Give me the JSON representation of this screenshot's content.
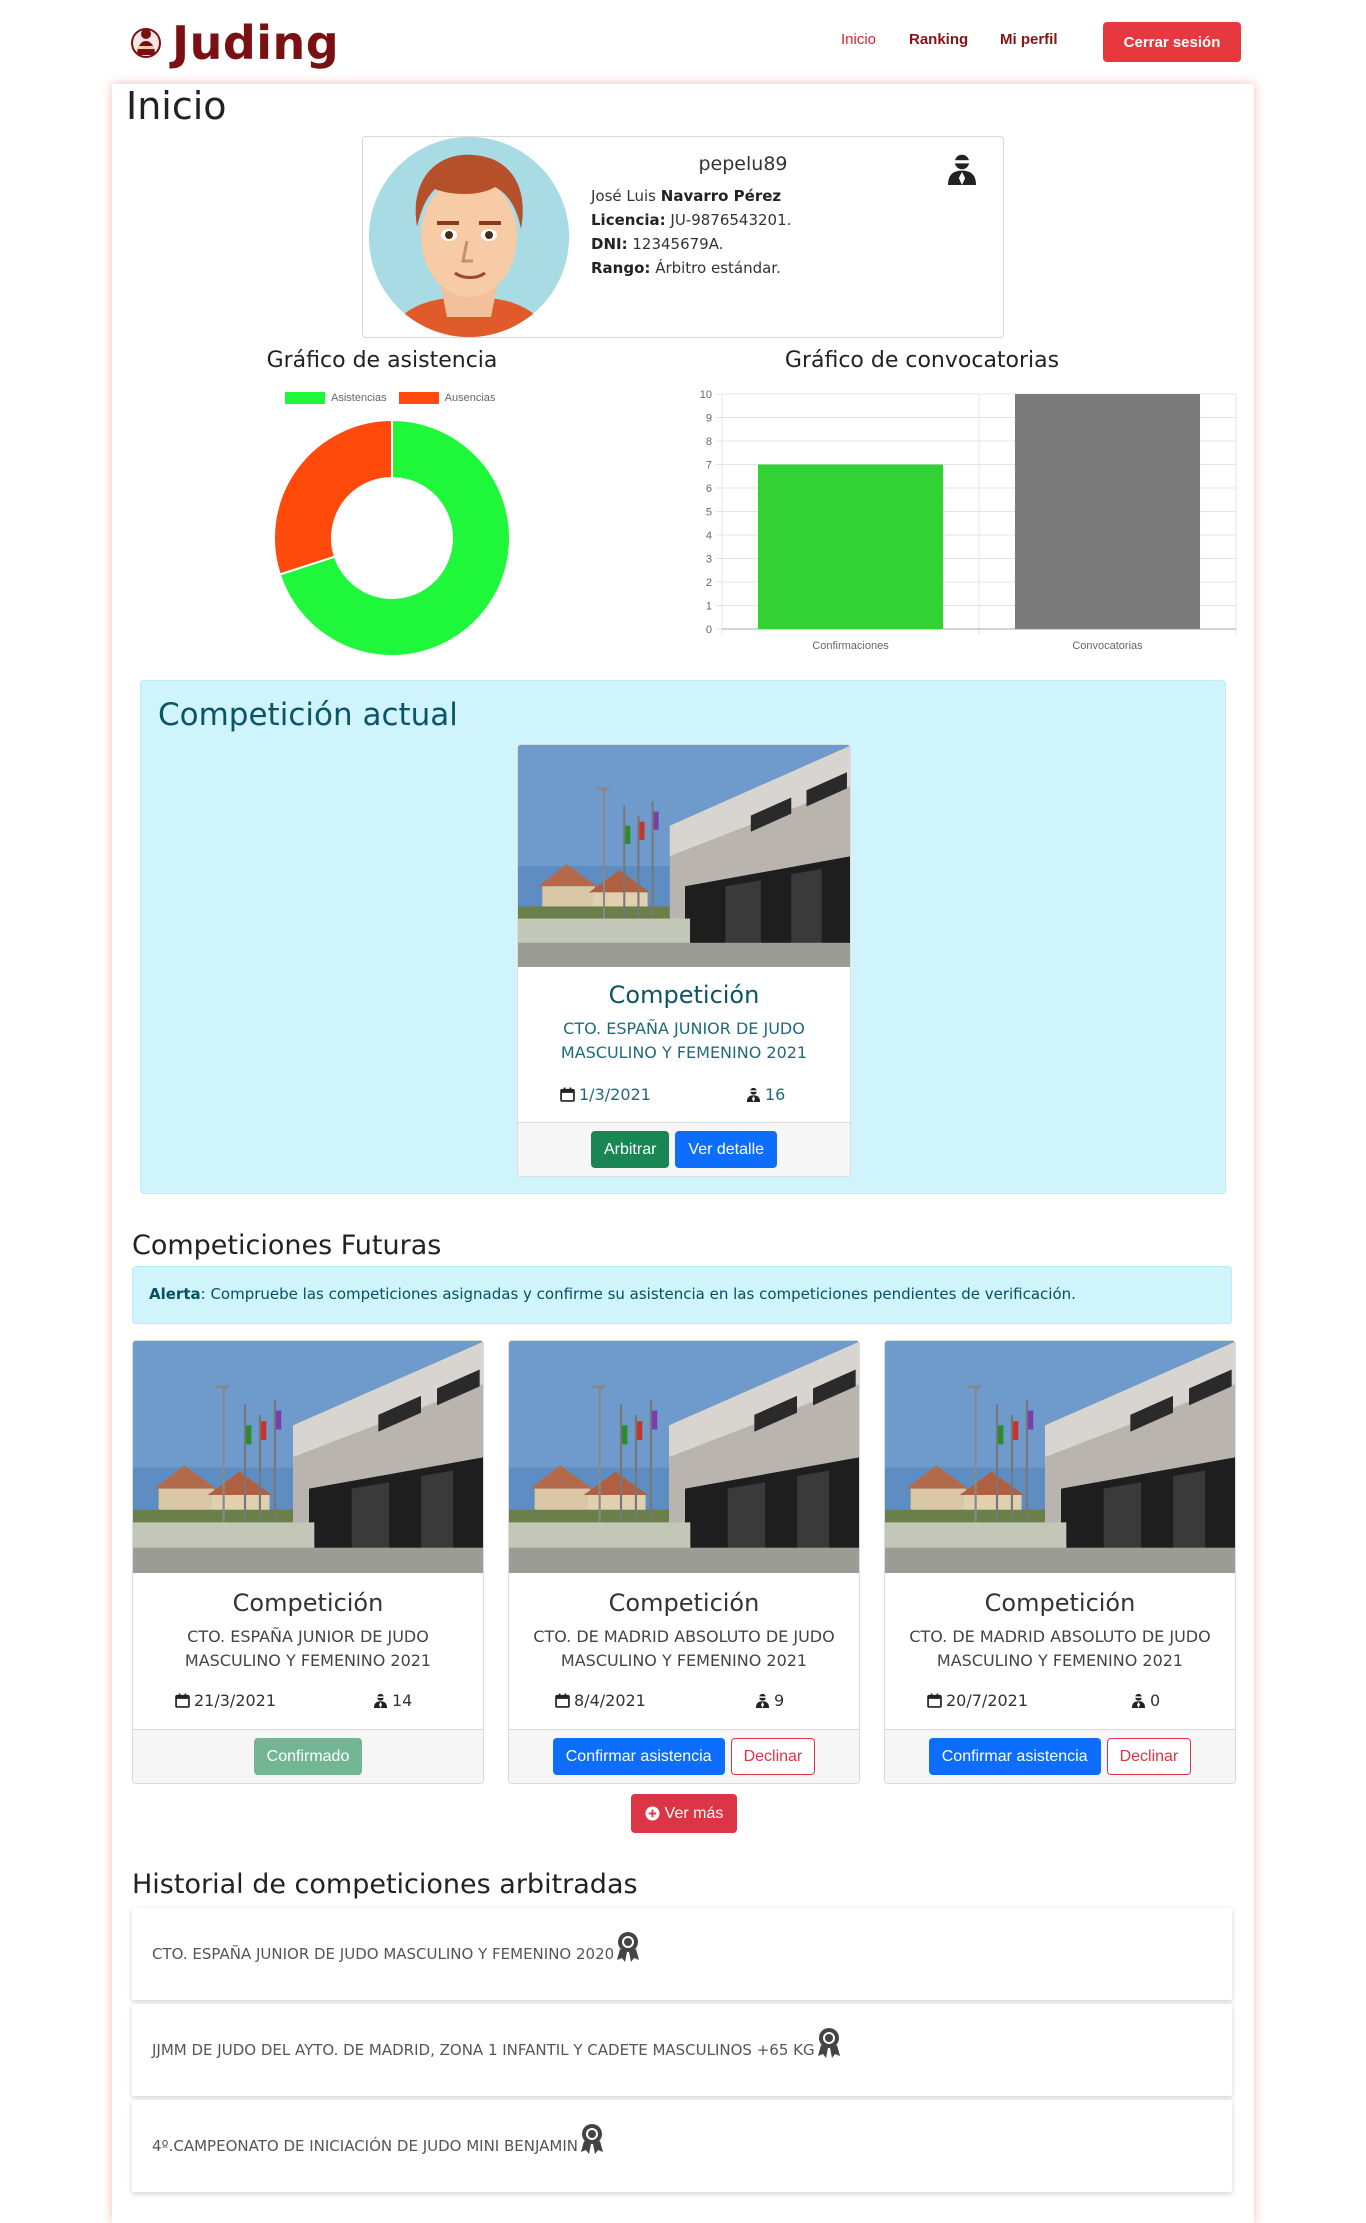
{
  "navbar": {
    "brand": "Juding",
    "links": [
      "Inicio",
      "Ranking",
      "Mi perfil"
    ],
    "logout": "Cerrar sesión"
  },
  "page": {
    "title": "Inicio"
  },
  "profile": {
    "username": "pepelu89",
    "name_first": "José Luis",
    "name_last": "Navarro Pérez",
    "license_label": "Licencia:",
    "license": "JU-9876543201.",
    "dni_label": "DNI:",
    "dni": "12345679A.",
    "rank_label": "Rango:",
    "rank": "Árbitro estándar."
  },
  "chart_data": [
    {
      "type": "pie",
      "title": "Gráfico de asistencia",
      "categories": [
        "Asistencias",
        "Ausencias"
      ],
      "values": [
        70,
        30
      ],
      "colors": [
        "#1ff73b",
        "#ff4a0c"
      ],
      "legend": "top"
    },
    {
      "type": "bar",
      "title": "Gráfico de convocatorias",
      "categories": [
        "Confirmaciones",
        "Convocatorias"
      ],
      "values": [
        7,
        10
      ],
      "colors": [
        "#32d234",
        "#7b7b7b"
      ],
      "ylim": [
        0,
        10
      ],
      "yticks": [
        "0",
        "1",
        "2",
        "3",
        "4",
        "5",
        "6",
        "7",
        "8",
        "9",
        "10"
      ],
      "grid": true
    }
  ],
  "current": {
    "section_title": "Competición actual",
    "card": {
      "title": "Competición",
      "name": "CTO. ESPAÑA JUNIOR DE JUDO MASCULINO Y FEMENINO 2021",
      "date": "1/3/2021",
      "referees": "16",
      "btn_referee": "Arbitrar",
      "btn_detail": "Ver detalle"
    }
  },
  "future": {
    "section_title": "Competiciones Futuras",
    "alert_label": "Alerta",
    "alert_text": ": Compruebe las competiciones asignadas y confirme su asistencia en las competiciones pendientes de verificación.",
    "cards": [
      {
        "title": "Competición",
        "name": "CTO. ESPAÑA JUNIOR DE JUDO MASCULINO Y FEMENINO 2021",
        "date": "21/3/2021",
        "referees": "14",
        "btn_confirmed": "Confirmado"
      },
      {
        "title": "Competición",
        "name": "CTO. DE MADRID ABSOLUTO DE JUDO MASCULINO Y FEMENINO 2021",
        "date": "8/4/2021",
        "referees": "9",
        "btn_confirm": "Confirmar asistencia",
        "btn_decline": "Declinar"
      },
      {
        "title": "Competición",
        "name": "CTO. DE MADRID ABSOLUTO DE JUDO MASCULINO Y FEMENINO 2021",
        "date": "20/7/2021",
        "referees": "0",
        "btn_confirm": "Confirmar asistencia",
        "btn_decline": "Declinar"
      }
    ],
    "more": "Ver más"
  },
  "history": {
    "section_title": "Historial de competiciones arbitradas",
    "items": [
      "CTO. ESPAÑA JUNIOR DE JUDO MASCULINO Y FEMENINO 2020",
      "JJMM DE JUDO DEL AYTO. DE MADRID, ZONA 1 INFANTIL Y CADETE MASCULINOS +65 KG",
      "4º.CAMPEONATO DE INICIACIÓN DE JUDO MINI BENJAMIN"
    ]
  },
  "colors": {
    "brand": "#7a1012",
    "logout": "#e8383f",
    "info_bg": "#cff4fc"
  }
}
